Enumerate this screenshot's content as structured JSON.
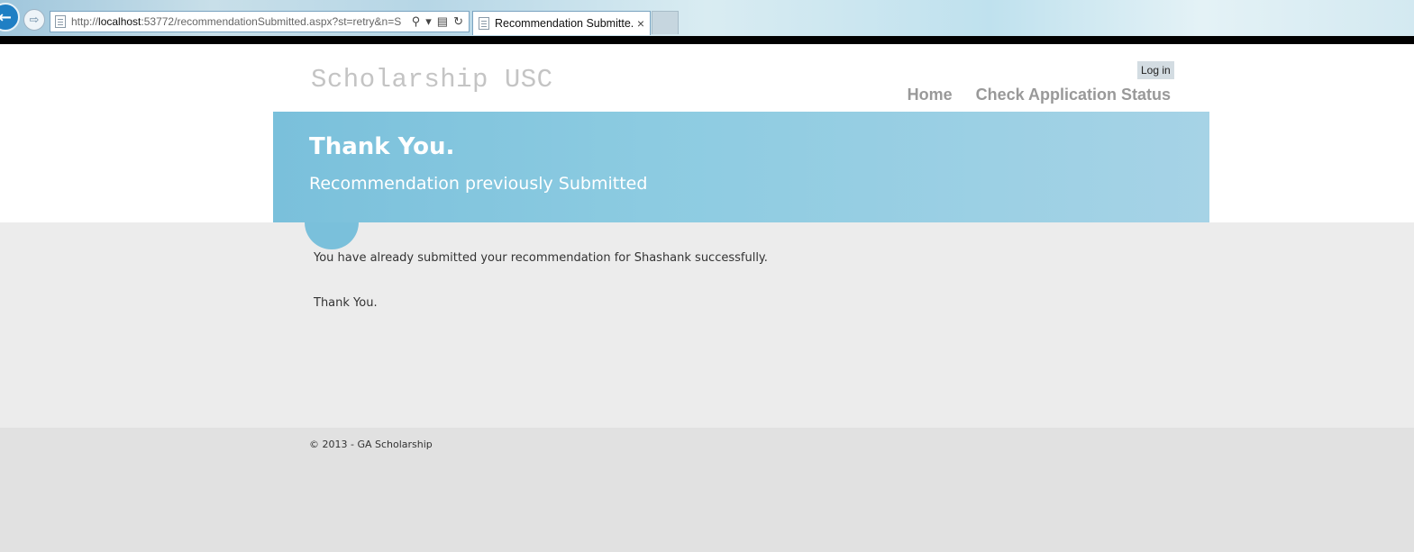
{
  "browser": {
    "url_prefix": "http://",
    "url_host": "localhost",
    "url_rest": ":53772/recommendationSubmitted.aspx?st=retry&n=S",
    "tab_title": "Recommendation Submitte...",
    "tab_close": "×"
  },
  "header": {
    "site_title": "Scholarship USC",
    "login_label": "Log in",
    "nav": {
      "home": "Home",
      "status": "Check Application Status"
    }
  },
  "featured": {
    "title": "Thank You.",
    "subtitle": "Recommendation previously Submitted"
  },
  "main": {
    "message": "You have already submitted your recommendation for Shashank successfully.",
    "closing": "Thank You."
  },
  "footer": {
    "copyright": "© 2013 - GA Scholarship"
  },
  "colors": {
    "accent": "#7ac0db",
    "body_bg": "#ececec",
    "footer_bg": "#e1e1e1"
  }
}
